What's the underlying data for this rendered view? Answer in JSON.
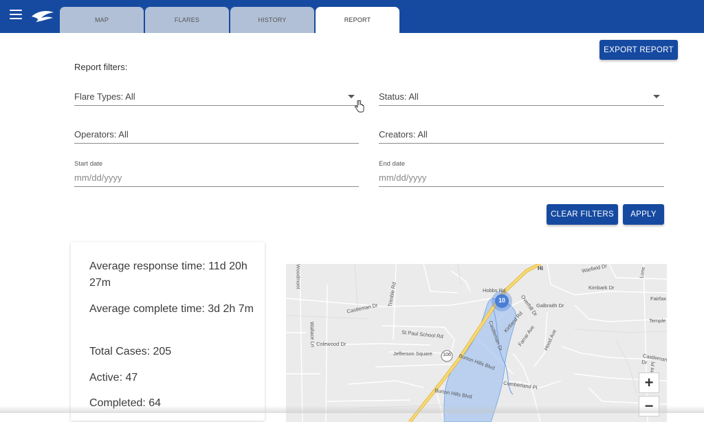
{
  "tabs": [
    {
      "label": "MAP"
    },
    {
      "label": "FLARES"
    },
    {
      "label": "HISTORY"
    },
    {
      "label": "REPORT"
    }
  ],
  "active_tab": "REPORT",
  "export_label": "EXPORT REPORT",
  "filters": {
    "title": "Report filters:",
    "flare_types": "Flare Types: All",
    "status": "Status: All",
    "operators": "Operators: All",
    "creators": "Creators: All",
    "start_date_label": "Start date",
    "start_date_placeholder": "mm/dd/yyyy",
    "end_date_label": "End date",
    "end_date_placeholder": "mm/dd/yyyy"
  },
  "buttons": {
    "clear": "CLEAR FILTERS",
    "apply": "APPLY"
  },
  "stats": {
    "avg_response": "Average response time: 11d 20h 27m",
    "avg_complete": "Average complete time: 3d 2h 7m",
    "total_cases": "Total Cases: 205",
    "active": "Active: 47",
    "completed": "Completed: 64"
  },
  "map": {
    "cluster_count": "10",
    "zoom_in": "+",
    "zoom_out": "−",
    "streets": {
      "hobbs": "Hobbs Rd",
      "warfield": "Warfield Dr",
      "kimbark": "Kimbark Dr",
      "galbraith": "Galbraith Dr",
      "overhill": "Overhill Dr",
      "castleman": "Castleman Dr",
      "trimble": "Trimble Rd",
      "wallace": "Wallace Ln",
      "colewood": "Colewood Dr",
      "stpaul": "St Paul School Rd",
      "jefferson": "Jefferson Square",
      "burton_hills": "Burton Hills Blvd",
      "burton_hills_2": "Burton Hills Blvd",
      "kirtland": "Kirtland Rd",
      "farrar": "Farrar Ave",
      "hood": "Hood Ave",
      "cumberland": "Cumberland Pl",
      "castleman_e": "Castleman Dr",
      "castleman_s": "Castleman Dr",
      "route": "106",
      "hi": "Hi",
      "temple": "Temple",
      "fairfax": "Fairfax",
      "lone": "Lone",
      "hunt": "Hunt Pl",
      "woodmont": "Woodmont"
    }
  },
  "colors": {
    "brand": "#164aa1",
    "tab_inactive": "#b1c0d6",
    "highway": "#f2d06b",
    "area": "#a9c7ef",
    "cluster": "#4a7fd6"
  }
}
